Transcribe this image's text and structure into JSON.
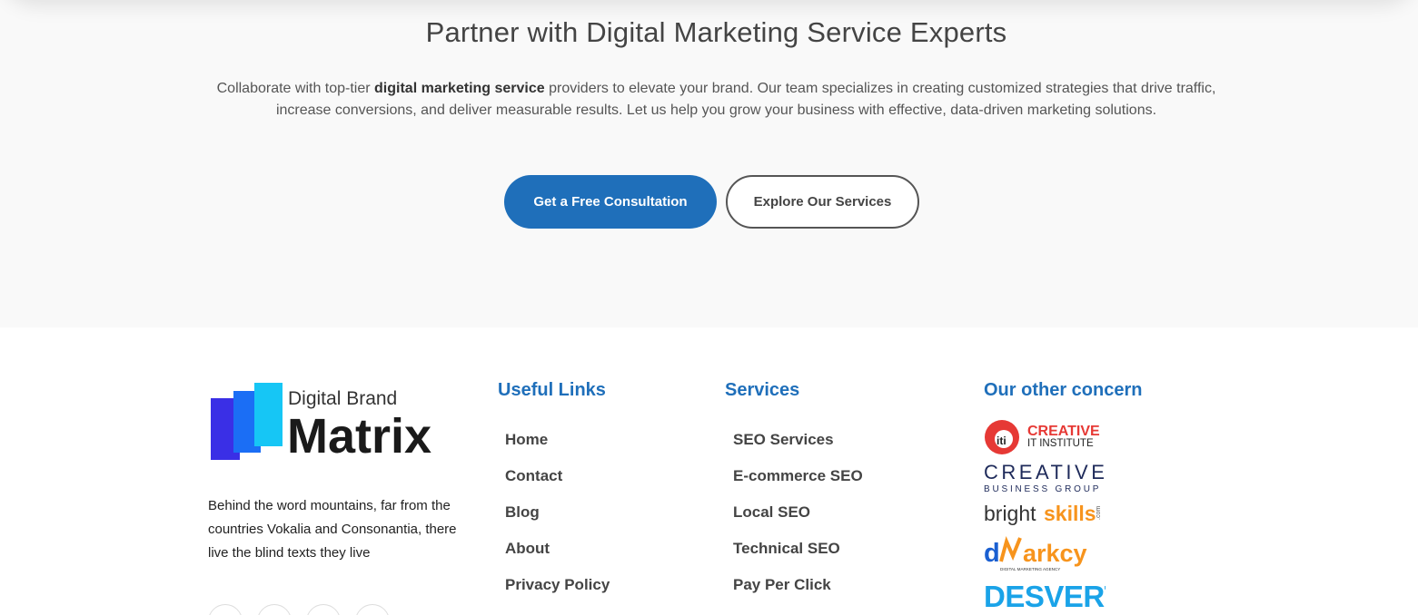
{
  "cta": {
    "title": "Partner with Digital Marketing Service Experts",
    "desc_prefix": "Collaborate with top-tier ",
    "desc_bold": "digital marketing service",
    "desc_suffix": " providers to elevate your brand. Our team specializes in creating customized strategies that drive traffic, increase conversions, and deliver measurable results. Let us help you grow your business with effective, data-driven marketing solutions.",
    "primary_button": "Get a Free Consultation",
    "secondary_button": "Explore Our Services"
  },
  "footer": {
    "logo": {
      "line1": "Digital Brand",
      "line2": "Matrix"
    },
    "about": "Behind the word mountains, far from the countries Vokalia and Consonantia, there live the blind texts they live",
    "useful_links": {
      "title": "Useful Links",
      "items": [
        "Home",
        "Contact",
        "Blog",
        "About",
        "Privacy Policy"
      ]
    },
    "services": {
      "title": "Services",
      "items": [
        "SEO Services",
        "E-commerce SEO",
        "Local SEO",
        "Technical SEO",
        "Pay Per Click"
      ]
    },
    "concerns": {
      "title": "Our other concern",
      "logos": {
        "creative_it": {
          "mark": "iti",
          "line1": "CREATIVE",
          "line2": "IT INSTITUTE"
        },
        "creative_bg": {
          "line1": "CREATIVE",
          "line2": "BUSINESS GROUP"
        },
        "brightskills": {
          "part1": "bright",
          "part2": "skills",
          "suffix": ".com"
        },
        "dmarkcy": {
          "part1": "d",
          "part2": "arkcy",
          "tagline": "DIGITAL MARKETING AGENCY"
        },
        "desvert": {
          "text": "DESVERT"
        }
      }
    },
    "social_icons": [
      "facebook-icon",
      "twitter-icon",
      "linkedin-icon",
      "instagram-icon"
    ]
  },
  "colors": {
    "accent": "#1f6fba",
    "cta_bg": "#f9f9f9",
    "creative_red": "#e63935",
    "bright_orange": "#f7941d",
    "logo_blue_dark": "#3a2fe6",
    "logo_blue_mid": "#1b6ef5",
    "logo_cyan": "#16c6f5"
  }
}
